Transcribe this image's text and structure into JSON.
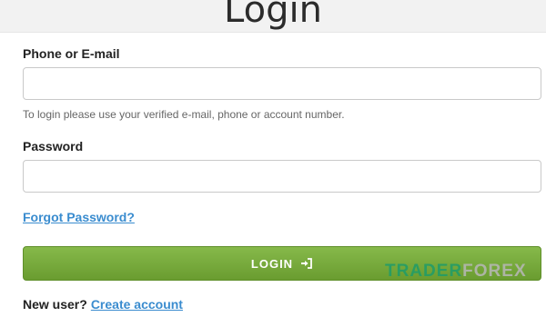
{
  "page": {
    "title": "Login"
  },
  "form": {
    "phone_label": "Phone or E-mail",
    "phone_value": "",
    "phone_hint": "To login please use your verified e-mail, phone or account number.",
    "password_label": "Password",
    "password_value": "",
    "forgot_label": "Forgot Password?",
    "login_label": "LOGIN",
    "new_user_text": "New user?",
    "create_account_label": "Create account"
  },
  "watermark": {
    "part1": "TRADER",
    "part2": "FOREX"
  },
  "colors": {
    "accent": "#3a8ccf",
    "button": "#7aac3e",
    "watermark_green": "#1e9c6a"
  },
  "icons": {
    "login": "sign-in-icon"
  }
}
